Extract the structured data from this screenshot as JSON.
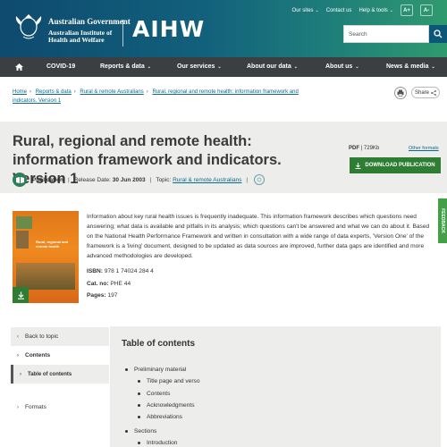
{
  "header": {
    "gov_name": "Australian Government",
    "agency_name": "Australian Institute of Health and Welfare",
    "logo_text": "AIHW",
    "top_links": [
      "Our sites",
      "Contact us",
      "Help & tools"
    ],
    "font_increase": "A+",
    "font_decrease": "A-",
    "search_placeholder": "Search"
  },
  "nav": {
    "items": [
      "COVID-19",
      "Reports & data",
      "Our services",
      "About our data",
      "About us",
      "News & media"
    ]
  },
  "breadcrumb": [
    "Home",
    "Reports & data",
    "Rural & remote Australians",
    "Rural, regional and remote health: information framework and indicators. Version 1"
  ],
  "share_label": "Share",
  "report": {
    "title": "Rural, regional and remote health: information framework and indicators. Version 1",
    "type": "Publication",
    "release_label": "Release Date:",
    "release_date": "30 Jun 2003",
    "topic_label": "Topic:",
    "topic": "Rural & remote Australians",
    "pdf_format": "PDF",
    "pdf_size": "729Kb",
    "other_formats": "Other formats",
    "download_label": "DOWNLOAD PUBLICATION",
    "cover_title": "Rural, regional and remote health",
    "description": "Information about key rural health issues is frequently inadequate. This information framework describes which questions need answering; what data is available and pitfalls in its analysis; which questions can't be answered and what we can do about it. Based on the National Health Performance Framework and written in consultation with a wide range of data experts, 'Version One' of the framework is a 'living' document, designed to be updated as data sources are improved, further data gaps are identified and more advanced methodologies are developed.",
    "isbn_label": "ISBN:",
    "isbn": "978 1 74024 284 4",
    "cat_label": "Cat. no:",
    "cat_no": "PHE 44",
    "pages_label": "Pages:",
    "pages": "197"
  },
  "feedback_label": "FEEDBACK",
  "sidenav": {
    "back": "Back to topic",
    "contents": "Contents",
    "toc": "Table of contents",
    "formats": "Formats"
  },
  "toc": {
    "title": "Table of contents",
    "items": [
      {
        "label": "Preliminary material",
        "level": 1
      },
      {
        "label": "Title page and verso",
        "level": 2
      },
      {
        "label": "Contents",
        "level": 2
      },
      {
        "label": "Acknowledgments",
        "level": 2
      },
      {
        "label": "Abbreviations",
        "level": 2
      },
      {
        "label": "Sections",
        "level": 1
      },
      {
        "label": "Introduction",
        "level": 2
      }
    ]
  }
}
